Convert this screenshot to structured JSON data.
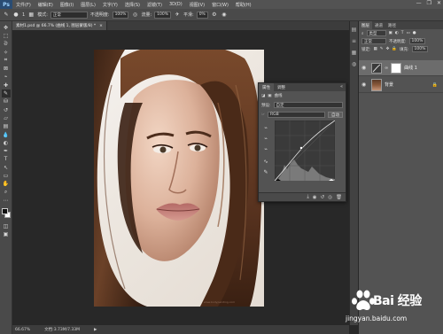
{
  "menubar": {
    "logo": "Ps",
    "items": [
      "文件(F)",
      "编辑(E)",
      "图像(I)",
      "图层(L)",
      "文字(Y)",
      "选择(S)",
      "滤镜(T)",
      "3D(D)",
      "视图(V)",
      "窗口(W)",
      "帮助(H)"
    ],
    "window_controls": [
      "—",
      "❐",
      "✕"
    ]
  },
  "options": {
    "size": "1",
    "mode_label": "模式:",
    "mode_value": "正常",
    "opacity_label": "不透明度:",
    "opacity_value": "100%",
    "flow_label": "流量:",
    "flow_value": "100%",
    "smooth_label": "平滑:",
    "smooth_value": "0%"
  },
  "document": {
    "tab_title": "素材1.psd @ 66.7% (曲线 1, 图层蒙版/8) *",
    "tab_close": "×",
    "watermark_text": "www.bodypainting.com"
  },
  "statusbar": {
    "zoom": "66.67%",
    "doc_size": "文档:3.73M/7.33M",
    "arrow": "▶"
  },
  "properties": {
    "tabs": [
      "属性",
      "调整"
    ],
    "close": "«",
    "menu": "≡",
    "header": "曲线",
    "preset_label": "预设:",
    "preset_value": "自定",
    "channel_value": "RGB",
    "auto_button": "自动"
  },
  "panel": {
    "tabs": [
      "图层",
      "通道",
      "路径"
    ],
    "kind_value": "类型",
    "blend_value": "正常",
    "opacity_label": "不透明度:",
    "opacity_value": "100%",
    "lock_label": "锁定:",
    "fill_label": "填充:",
    "fill_value": "100%",
    "layers": [
      {
        "name": "曲线 1",
        "selected": true
      },
      {
        "name": "背景",
        "selected": false
      }
    ]
  },
  "watermark": {
    "brand": "Bai 经验",
    "url": "jingyan.baidu.com"
  },
  "colors": {
    "menubar_bg": "#535353",
    "options_bg": "#4a4a4a",
    "canvas_bg": "#282828",
    "panel_bg": "#535353",
    "selected_layer": "#6c6c6c",
    "ps_blue": "#2a4c73"
  }
}
